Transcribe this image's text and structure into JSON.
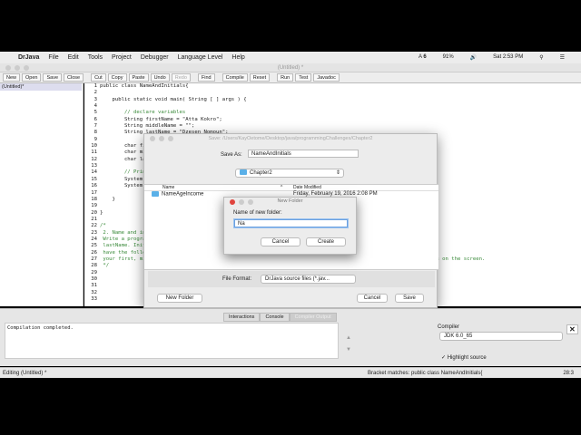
{
  "menubar": {
    "items": [
      "DrJava",
      "File",
      "Edit",
      "Tools",
      "Project",
      "Debugger",
      "Language Level",
      "Help"
    ],
    "status": {
      "adobe": "6",
      "battery": "91%",
      "clock": "Sat 2:53 PM"
    }
  },
  "window": {
    "title": "(Untitled) *"
  },
  "toolbar": {
    "new": "New",
    "open": "Open",
    "save": "Save",
    "close": "Close",
    "cut": "Cut",
    "copy": "Copy",
    "paste": "Paste",
    "undo": "Undo",
    "redo": "Redo",
    "find": "Find",
    "compile": "Compile",
    "reset": "Reset",
    "run": "Run",
    "test": "Test",
    "javadoc": "Javadoc"
  },
  "documents": [
    "(Untitled)*"
  ],
  "code": [
    "public class NameAndInitials{",
    "",
    "    public static void main( String [ ] args ) {",
    "",
    "        // declare variables",
    "        String firstName = \"Atta Kokro\";",
    "        String middleName = \"\";",
    "        String lastName = \"Dzesen Nomoun\";",
    "",
    "        char fi",
    "        char mi",
    "        char la",
    "",
    "        // Prin",
    "        System.",
    "        System.",
    "",
    "    }",
    "",
    "}",
    "",
    "/*",
    " 2. Name and in",
    " Write a progra",
    " lastName. Init",
    " have the follo",
    " your first, mi                                                                                       variables on the screen.",
    " */",
    "",
    "",
    "",
    "",
    ""
  ],
  "save_dialog": {
    "title": "Save:  /Users/KayOetome/Desktop/java/programmingChallenges/Chapter2",
    "save_as_label": "Save As:",
    "save_as_value": "NameAndInitials",
    "location": "Chapter2",
    "col_name": "Name",
    "col_date": "Date Modified",
    "files": [
      {
        "name": "NameAgeIncome",
        "date": "Friday, February 19, 2016 2:08 PM"
      }
    ],
    "file_format_label": "File Format:",
    "file_format": "DrJava source files (*.jav...",
    "new_folder": "New Folder",
    "cancel": "Cancel",
    "save": "Save"
  },
  "new_folder_dialog": {
    "title": "New Folder",
    "label": "Name of new folder:",
    "value": "Na",
    "cancel": "Cancel",
    "create": "Create"
  },
  "bottom": {
    "tabs": [
      "Interactions",
      "Console",
      "Compiler Output"
    ],
    "console_text": "Compilation completed.",
    "compiler_label": "Compiler",
    "compiler": "JDK 6.0_65",
    "highlight": "Highlight source",
    "close": "✕"
  },
  "status": {
    "left": "Editing (Untitled) *",
    "middle": "Bracket matches: public class NameAndInitials{",
    "pos": "28:3"
  }
}
